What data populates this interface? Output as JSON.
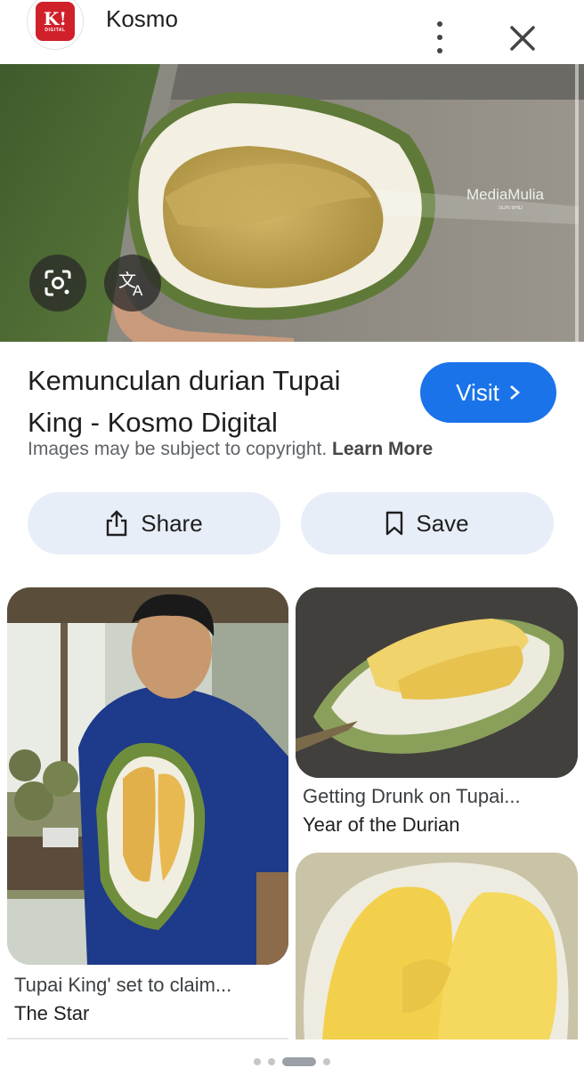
{
  "header": {
    "site_name": "Kosmo",
    "logo_text": "K!",
    "logo_sub": "DIGITAL"
  },
  "hero": {
    "watermark": "MediaMulia",
    "watermark_sub": "SDN BHD",
    "lens_icon": "google-lens-icon",
    "translate_icon": "translate-icon"
  },
  "result": {
    "title": "Kemunculan durian Tupai King - Kosmo Digital",
    "visit_label": "Visit",
    "copyright_text": "Images may be subject to copyright.",
    "learn_more": "Learn More",
    "share_label": "Share",
    "save_label": "Save"
  },
  "related": [
    {
      "title": "Tupai King' set to claim...",
      "source": "The Star"
    },
    {
      "title": "Getting Drunk on Tupai...",
      "source": "Year of the Durian"
    }
  ],
  "colors": {
    "accent": "#1a73e8",
    "pill_bg": "#e8eef8",
    "logo_red": "#d0202a"
  }
}
